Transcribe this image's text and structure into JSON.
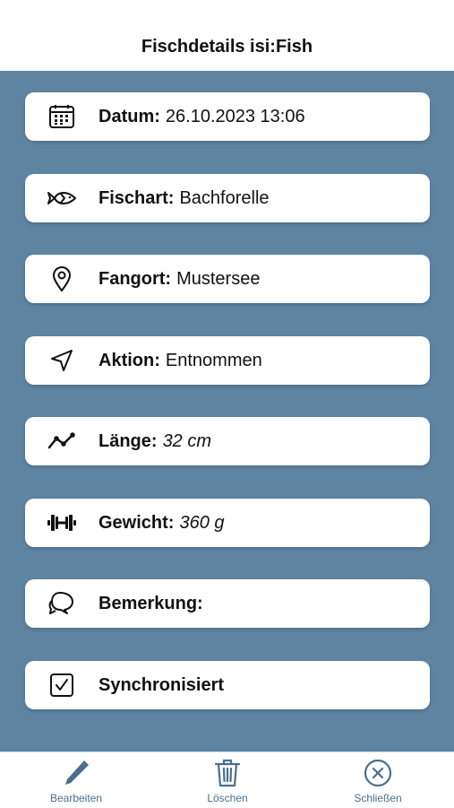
{
  "header": {
    "title": "Fischdetails isi:Fish"
  },
  "details": [
    {
      "id": "datum",
      "icon": "calendar-icon",
      "label": "Datum:",
      "value": "26.10.2023 13:06",
      "italic": false
    },
    {
      "id": "fischart",
      "icon": "fish-icon",
      "label": "Fischart:",
      "value": "Bachforelle",
      "italic": false
    },
    {
      "id": "fangort",
      "icon": "map-pin-icon",
      "label": "Fangort:",
      "value": "Mustersee",
      "italic": false
    },
    {
      "id": "aktion",
      "icon": "navigation-arrow-icon",
      "label": "Aktion:",
      "value": "Entnommen",
      "italic": false
    },
    {
      "id": "laenge",
      "icon": "line-chart-icon",
      "label": "Länge:",
      "value": "32 cm",
      "italic": true
    },
    {
      "id": "gewicht",
      "icon": "dumbbell-icon",
      "label": "Gewicht:",
      "value": "360 g",
      "italic": true
    },
    {
      "id": "bemerkung",
      "icon": "speech-bubbles-icon",
      "label": "Bemerkung:",
      "value": "",
      "italic": false
    },
    {
      "id": "synchronisiert",
      "icon": "checkbox-checked-icon",
      "label": "Synchronisiert",
      "value": "",
      "italic": false
    }
  ],
  "tabbar": {
    "edit_label": "Bearbeiten",
    "delete_label": "Löschen",
    "close_label": "Schließen"
  },
  "colors": {
    "background": "#5f84a2",
    "card": "#ffffff",
    "accent": "#4a6f8d"
  }
}
